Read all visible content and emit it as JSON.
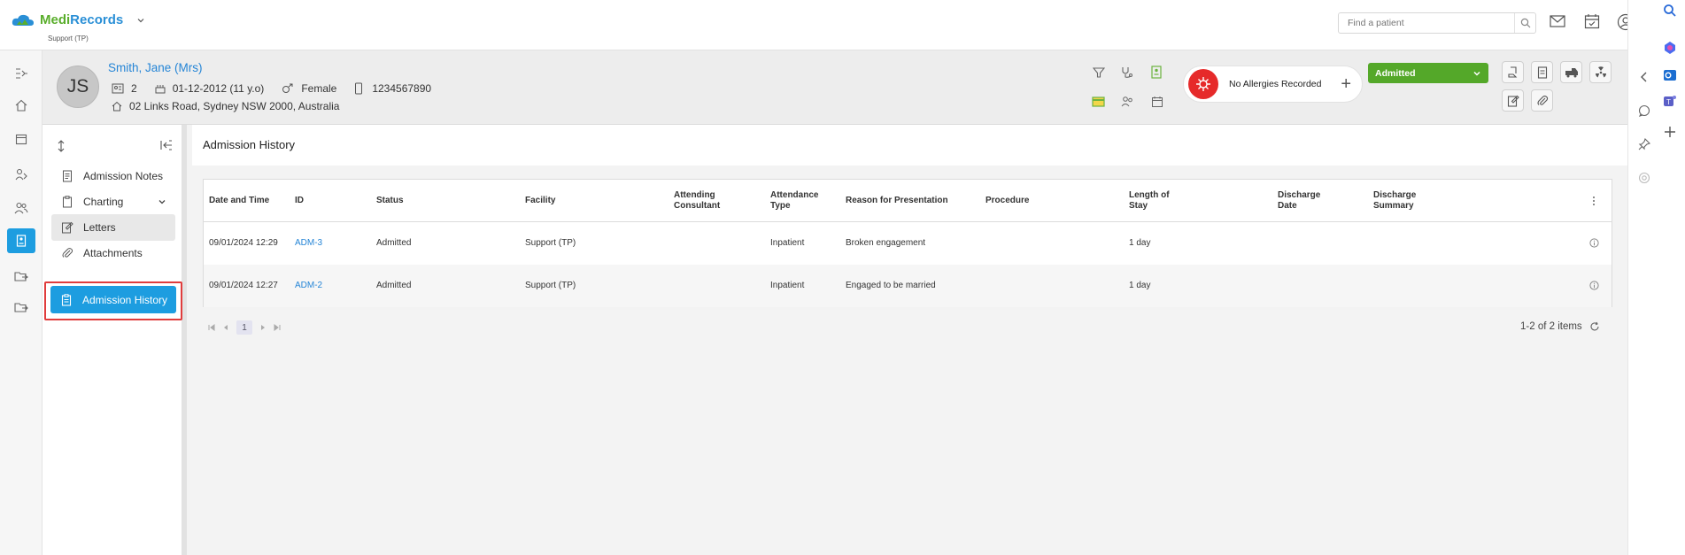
{
  "app": {
    "brand_prefix": "Medi",
    "brand_suffix": "Records",
    "org": "Support (TP)",
    "search_placeholder": "Find a patient"
  },
  "patient": {
    "initials": "JS",
    "name": "Smith, Jane (Mrs)",
    "id_number": "2",
    "dob": "01-12-2012 (11 y.o)",
    "gender": "Female",
    "phone": "1234567890",
    "address": "02 Links Road, Sydney NSW 2000, Australia",
    "allergy_text": "No Allergies Recorded",
    "status": "Admitted"
  },
  "subnav": {
    "items": [
      {
        "label": "Admission Notes"
      },
      {
        "label": "Charting"
      },
      {
        "label": "Letters"
      },
      {
        "label": "Attachments"
      },
      {
        "label": "Admission History"
      }
    ]
  },
  "main": {
    "title": "Admission History",
    "columns": [
      {
        "l1": "Date and Time",
        "l2": ""
      },
      {
        "l1": "ID",
        "l2": ""
      },
      {
        "l1": "Status",
        "l2": ""
      },
      {
        "l1": "Facility",
        "l2": ""
      },
      {
        "l1": "Attending",
        "l2": "Consultant"
      },
      {
        "l1": "Attendance",
        "l2": "Type"
      },
      {
        "l1": "Reason for Presentation",
        "l2": ""
      },
      {
        "l1": "Procedure",
        "l2": ""
      },
      {
        "l1": "Length of",
        "l2": "Stay"
      },
      {
        "l1": "Discharge",
        "l2": "Date"
      },
      {
        "l1": "Discharge",
        "l2": "Summary"
      }
    ],
    "rows": [
      {
        "datetime": "09/01/2024 12:29",
        "id": "ADM-3",
        "status": "Admitted",
        "facility": "Support (TP)",
        "consultant": "",
        "type": "Inpatient",
        "reason": "Broken engagement",
        "procedure": "",
        "los": "1 day",
        "ddate": "",
        "dsummary": ""
      },
      {
        "datetime": "09/01/2024 12:27",
        "id": "ADM-2",
        "status": "Admitted",
        "facility": "Support (TP)",
        "consultant": "",
        "type": "Inpatient",
        "reason": "Engaged to be married",
        "procedure": "",
        "los": "1 day",
        "ddate": "",
        "dsummary": ""
      }
    ],
    "pager_current": "1",
    "items_count": "1-2 of 2 items"
  },
  "colors": {
    "accent": "#1d9de0",
    "status_green": "#54a829",
    "allergy_red": "#e62a2a",
    "link": "#2585d6"
  }
}
